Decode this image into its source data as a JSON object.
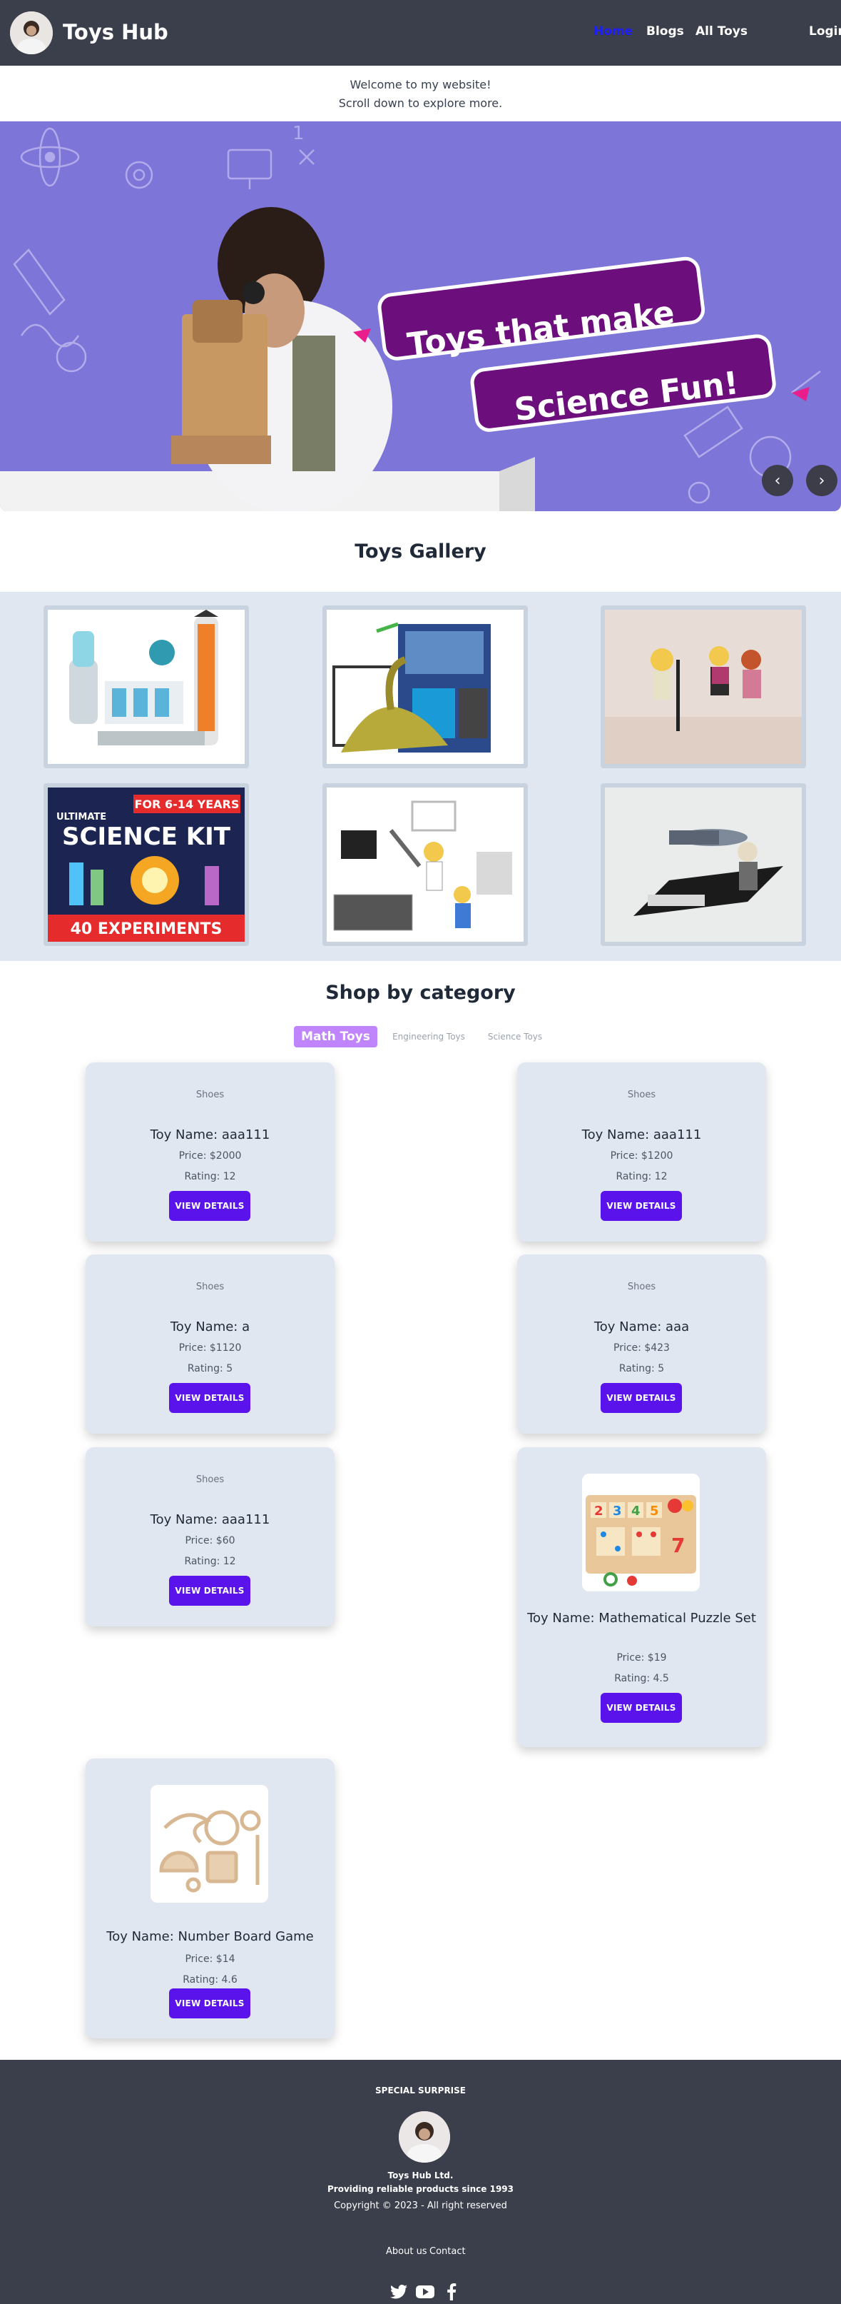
{
  "navbar": {
    "brand": "Toys Hub",
    "links": [
      "Home",
      "Blogs",
      "All Toys",
      "Login"
    ]
  },
  "welcome": {
    "line1": "Welcome to my website!",
    "line2": "Scroll down to explore more."
  },
  "banner": {
    "headline_line1": "Toys that make",
    "headline_line2": "Science Fun!",
    "prev_label": "‹",
    "next_label": "›"
  },
  "gallery": {
    "title": "Toys Gallery",
    "kit_badge": "FOR 6-14 YEARS",
    "kit_top": "ULTIMATE",
    "kit_title": "SCIENCE KIT",
    "kit_bottom": "40 EXPERIMENTS"
  },
  "shop": {
    "title": "Shop by category",
    "tabs": [
      "Math Toys",
      "Engineering Toys",
      "Science Toys"
    ],
    "button_label": "VIEW DETAILS",
    "cards": [
      {
        "alt": "Shoes",
        "name": "Toy Name: aaa111",
        "price": "Price: $2000",
        "rating": "Rating: 12"
      },
      {
        "alt": "Shoes",
        "name": "Toy Name: aaa111",
        "price": "Price: $1200",
        "rating": "Rating: 12"
      },
      {
        "alt": "Shoes",
        "name": "Toy Name: a",
        "price": "Price: $1120",
        "rating": "Rating: 5"
      },
      {
        "alt": "Shoes",
        "name": "Toy Name: aaa",
        "price": "Price: $423",
        "rating": "Rating: 5"
      },
      {
        "alt": "Shoes",
        "name": "Toy Name: aaa111",
        "price": "Price: $60",
        "rating": "Rating: 12"
      },
      {
        "alt": "",
        "name": "Toy Name: Mathematical Puzzle Set",
        "price": "Price: $19",
        "rating": "Rating: 4.5"
      },
      {
        "alt": "",
        "name": "Toy Name: Number Board Game",
        "price": "Price: $14",
        "rating": "Rating: 4.6"
      }
    ]
  },
  "footer": {
    "heading": "SPECIAL SURPRISE",
    "company": "Toys Hub Ltd.",
    "tagline": "Providing reliable products since 1993",
    "copyright": "Copyright © 2023 - All right reserved",
    "links": [
      "About us",
      "Contact"
    ]
  }
}
